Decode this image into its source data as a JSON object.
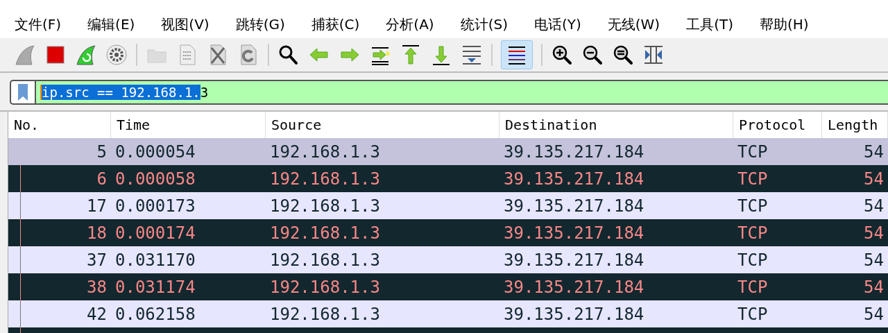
{
  "menu": [
    "文件(F)",
    "编辑(E)",
    "视图(V)",
    "跳转(G)",
    "捕获(C)",
    "分析(A)",
    "统计(S)",
    "电话(Y)",
    "无线(W)",
    "工具(T)",
    "帮助(H)"
  ],
  "toolbar": {
    "colorize_on": true
  },
  "filter": {
    "selected_text": "ip.src == 192.168.1.",
    "rest_text": "3"
  },
  "table": {
    "columns": [
      "No.",
      "Time",
      "Source",
      "Destination",
      "Protocol",
      "Length"
    ],
    "rows": [
      {
        "kind": "light",
        "selected": true,
        "cells": [
          "5",
          "0.000054",
          "192.168.1.3",
          "39.135.217.184",
          "TCP",
          "54"
        ]
      },
      {
        "kind": "dark",
        "selected": false,
        "cells": [
          "6",
          "0.000058",
          "192.168.1.3",
          "39.135.217.184",
          "TCP",
          "54"
        ]
      },
      {
        "kind": "light",
        "selected": false,
        "cells": [
          "17",
          "0.000173",
          "192.168.1.3",
          "39.135.217.184",
          "TCP",
          "54"
        ]
      },
      {
        "kind": "dark",
        "selected": false,
        "cells": [
          "18",
          "0.000174",
          "192.168.1.3",
          "39.135.217.184",
          "TCP",
          "54"
        ]
      },
      {
        "kind": "light",
        "selected": false,
        "cells": [
          "37",
          "0.031170",
          "192.168.1.3",
          "39.135.217.184",
          "TCP",
          "54"
        ]
      },
      {
        "kind": "dark",
        "selected": false,
        "cells": [
          "38",
          "0.031174",
          "192.168.1.3",
          "39.135.217.184",
          "TCP",
          "54"
        ]
      },
      {
        "kind": "light",
        "selected": false,
        "cells": [
          "42",
          "0.062158",
          "192.168.1.3",
          "39.135.217.184",
          "TCP",
          "54"
        ]
      },
      {
        "kind": "dark",
        "selected": false,
        "cells": []
      }
    ]
  }
}
